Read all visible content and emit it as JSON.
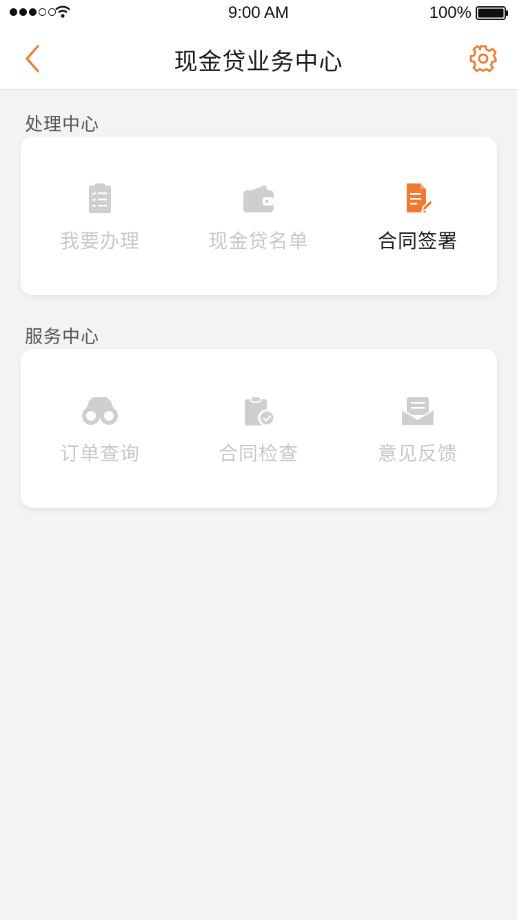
{
  "status_bar": {
    "time": "9:00 AM",
    "battery": "100%"
  },
  "nav": {
    "title": "现金贷业务中心",
    "back_icon": "chevron-left-icon",
    "settings_icon": "gear-icon"
  },
  "colors": {
    "accent": "#f07a32",
    "disabled": "#c8c8c8",
    "text": "#1a1a1a",
    "background": "#f4f3f4"
  },
  "sections": [
    {
      "title": "处理中心",
      "items": [
        {
          "label": "我要办理",
          "icon": "clipboard-list-icon",
          "active": false
        },
        {
          "label": "现金贷名单",
          "icon": "wallet-icon",
          "active": false
        },
        {
          "label": "合同签署",
          "icon": "document-edit-icon",
          "active": true
        }
      ]
    },
    {
      "title": "服务中心",
      "items": [
        {
          "label": "订单查询",
          "icon": "binoculars-icon",
          "active": false
        },
        {
          "label": "合同检查",
          "icon": "clipboard-check-icon",
          "active": false
        },
        {
          "label": "意见反馈",
          "icon": "envelope-icon",
          "active": false
        }
      ]
    }
  ]
}
